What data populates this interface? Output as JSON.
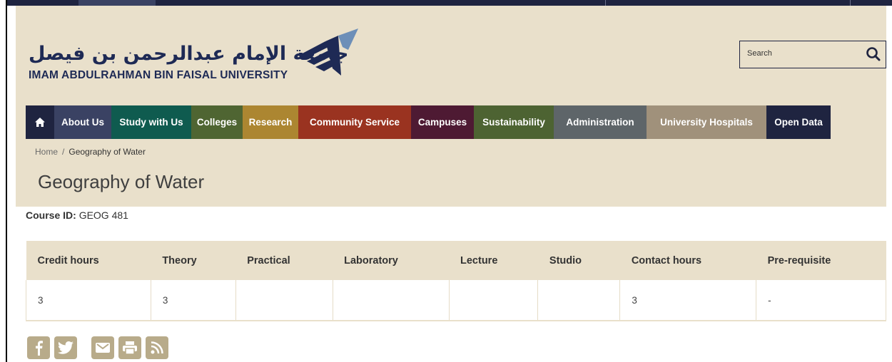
{
  "logo": {
    "arabic_name": "جامعة الإمام عبدالرحمن بن فيصل",
    "english_name": "IMAM ABDULRAHMAN BIN FAISAL UNIVERSITY"
  },
  "search": {
    "placeholder": "Search",
    "icon": "search-icon"
  },
  "nav": {
    "items": [
      {
        "label": "",
        "icon": "home-icon",
        "color": "#1f2440"
      },
      {
        "label": "About Us",
        "color": "#3a4263"
      },
      {
        "label": "Study with Us",
        "color": "#0f5b4f"
      },
      {
        "label": "Colleges",
        "color": "#4f6532"
      },
      {
        "label": "Research",
        "color": "#ac8631"
      },
      {
        "label": "Community Service",
        "color": "#9a3320"
      },
      {
        "label": "Campuses",
        "color": "#4e1a33"
      },
      {
        "label": "Sustainability",
        "color": "#4d6332"
      },
      {
        "label": "Administration",
        "color": "#5e6569"
      },
      {
        "label": "University Hospitals",
        "color": "#a0917b"
      },
      {
        "label": "Open Data",
        "color": "#1f2440"
      }
    ]
  },
  "breadcrumb": {
    "home": "Home",
    "separator": "/",
    "current": "Geography of Water"
  },
  "page": {
    "title": "Geography of Water"
  },
  "course": {
    "id_label": "Course ID:",
    "id_value": "GEOG 481"
  },
  "table": {
    "headers": [
      "Credit hours",
      "Theory",
      "Practical",
      "Laboratory",
      "Lecture",
      "Studio",
      "Contact hours",
      "Pre-requisite"
    ],
    "row": [
      "3",
      "3",
      "",
      "",
      "",
      "",
      "3",
      "-"
    ]
  },
  "social": [
    "facebook-icon",
    "twitter-icon",
    "email-icon",
    "print-icon",
    "rss-icon"
  ],
  "colors": {
    "header_bg": "#e9e0cb",
    "navy": "#1f2440",
    "social": "#b8ab8a"
  }
}
